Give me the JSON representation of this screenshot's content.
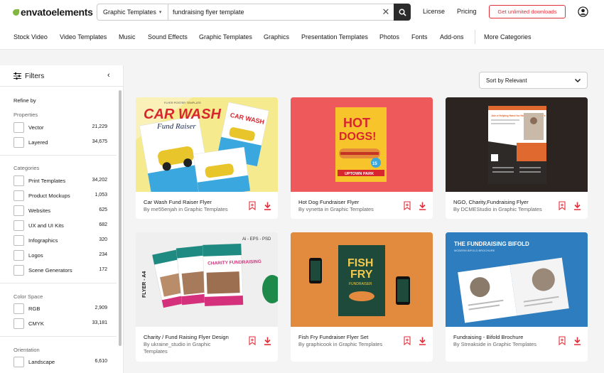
{
  "header": {
    "logo_text": "envatoelements",
    "search": {
      "category": "Graphic Templates",
      "query": "fundraising flyer template"
    },
    "nav": [
      "License",
      "Pricing"
    ],
    "cta": "Get unlimited downloads",
    "brand_color": "#82b541",
    "cta_color": "#e0303b"
  },
  "categories": [
    "Stock Video",
    "Video Templates",
    "Music",
    "Sound Effects",
    "Graphic Templates",
    "Graphics",
    "Presentation Templates",
    "Photos",
    "Fonts",
    "Add-ons",
    "More Categories"
  ],
  "filters": {
    "title": "Filters",
    "refine_by": "Refine by",
    "groups": [
      {
        "name": "Properties",
        "options": [
          {
            "label": "Vector",
            "count": "21,229"
          },
          {
            "label": "Layered",
            "count": "34,675"
          }
        ]
      },
      {
        "name": "Categories",
        "options": [
          {
            "label": "Print Templates",
            "count": "34,202"
          },
          {
            "label": "Product Mockups",
            "count": "1,053"
          },
          {
            "label": "Websites",
            "count": "625"
          },
          {
            "label": "UX and UI Kits",
            "count": "682"
          },
          {
            "label": "Infographics",
            "count": "320"
          },
          {
            "label": "Logos",
            "count": "234"
          },
          {
            "label": "Scene Generators",
            "count": "172"
          }
        ]
      },
      {
        "name": "Color Space",
        "options": [
          {
            "label": "RGB",
            "count": "2,909"
          },
          {
            "label": "CMYK",
            "count": "33,181"
          }
        ]
      },
      {
        "name": "Orientation",
        "options": [
          {
            "label": "Landscape",
            "count": "6,610"
          }
        ]
      }
    ]
  },
  "sort": {
    "label": "Sort by Relevant"
  },
  "cards": [
    {
      "title": "Car Wash Fund Raiser Flyer",
      "author": "By me55enjah in Graphic Templates",
      "thumb": {
        "small": "FLYER POSTER TEMPLATE",
        "line1": "CAR WASH",
        "line2": "Fund Raiser",
        "mini": "CAR WASH"
      }
    },
    {
      "title": "Hot Dog Fundraiser Flyer",
      "author": "By vynetta in Graphic Templates",
      "thumb": {
        "line1": "HOT",
        "line2": "DOGS!",
        "badge": "15",
        "banner": "UPTOWN PARK"
      }
    },
    {
      "title": "NGO, Charity,Fundraising Flyer",
      "author": "By DCMEStudio in Graphic Templates",
      "thumb": {
        "headline": "Join a Helping Hand for Homeless Children's"
      }
    },
    {
      "title": "Charity / Fund Raising Flyer Design",
      "author": "By ukraine_studio in Graphic Templates",
      "thumb": {
        "formats": "Ai - EPS - PSD",
        "side": "FLYER - A4",
        "headline": "CHARITY FUNDRAISING"
      }
    },
    {
      "title": "Fish Fry Fundraiser Flyer Set",
      "author": "By graphicook in Graphic Templates",
      "thumb": {
        "line1": "FISH",
        "line2": "FRY",
        "sub": "FUNDRAISER"
      }
    },
    {
      "title": "Fundraising - Bifold Brochure",
      "author": "By Streakside in Graphic Templates",
      "thumb": {
        "headline": "THE FUNDRAISING BIFOLD",
        "sub": "MODERN BIFOLD BROCHURE"
      }
    }
  ]
}
